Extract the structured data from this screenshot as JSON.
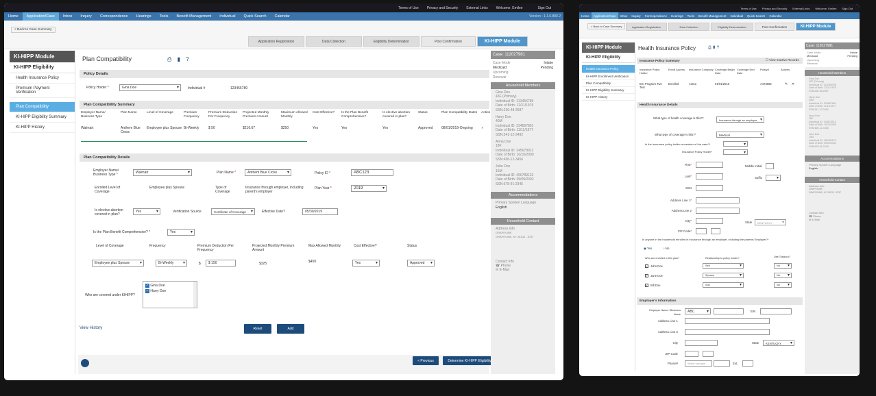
{
  "top_links": [
    "Terms of Use",
    "Privacy and Security",
    "External Links",
    "Welcome, Emilee",
    "Sign Out"
  ],
  "nav": [
    "Home",
    "Application/Case",
    "Inbox",
    "Inquiry",
    "Correspondence",
    "Hearings",
    "Tools",
    "Benefit Management",
    "Individual",
    "Quick Search",
    "Calendar"
  ],
  "version": "Version : 1.1.6.880.2",
  "version_short": "Version : 1.1.6.880.2",
  "back_label": "< Back to Case Summary",
  "steps": [
    "Application Registration",
    "Data Collection",
    "Eligibility Determination",
    "Post Confirmation"
  ],
  "module": "KI-HIPP Module",
  "left": {
    "module": "KI-HIPP Module",
    "section": "KI-HIPP Eligibility",
    "items": [
      "Health Insurance Policy",
      "Premium Payment Verification",
      "Plan Compatibility",
      "KI-HIPP Eligibility Summary",
      "KI-HIPP History"
    ]
  },
  "left2": {
    "module": "KI-HIPP Module",
    "section": "KI-HIPP Eligibility",
    "items": [
      "Health Insurance Policy",
      "KI-HIPP Enrollment Verification",
      "Plan Compatibility",
      "KI-HIPP Eligibility Summary",
      "KI-HIPP History"
    ]
  },
  "page1": {
    "title": "Plan Compatibility",
    "policy_details": "Policy Details",
    "policy_holder_lbl": "Policy Holder",
    "policy_holder": "Gina Doe",
    "individual_lbl": "Individual #",
    "individual": "123456789",
    "summary_title": "Plan Compatibility Summary",
    "summary_headers": [
      "Employer Name/ Business Type",
      "Plan Name",
      "Level of Coverage",
      "Premium Frequency",
      "Premium Deduction Per Frequency",
      "Projected Monthly Premium Amount",
      "Maximum Allowed Monthly",
      "Cost Effective?",
      "Is the Plan Benefit Comprehensive?",
      "Is elective abortion covered in plan?",
      "Status",
      "Plan Compatibility Dates",
      "Action"
    ],
    "summary_row": [
      "Walmart",
      "Anthem Blue Cross",
      "Employee plus Spouse",
      "Bi-Weekly",
      "$ 50",
      "$216.67",
      "$250",
      "Yes",
      "Yes",
      "Yes",
      "Approved",
      "08/01/2019-Ongoing",
      "✓"
    ],
    "details_title": "Plan Compatibility Details",
    "employer_lbl": "Employer Name/ Business Type",
    "employer": "Walmart",
    "plan_name_lbl": "Plan Name",
    "plan_name": "Anthem Blue Cross",
    "policy_id_lbl": "Policy ID",
    "policy_id": "ABC123",
    "enrolled_lbl": "Enrolled Level of Coverage",
    "enrolled": "Employee plus Spouse",
    "type_lbl": "Type of Coverage",
    "type": "Insurance through employer, including parent's employer",
    "plan_year_lbl": "Plan Year",
    "plan_year": "2019",
    "abortion_lbl": "Is elective abortion covered in plan?",
    "abortion": "Yes",
    "verif_lbl": "Verification Source",
    "verif": "Certificate of Coverage",
    "eff_lbl": "Effective Date?",
    "eff": "05/30/2019",
    "comp_lbl": "Is the Plan Benefit Comprehensive?",
    "comp": "Yes",
    "grid_headers": [
      "Level of Coverage",
      "Frequency",
      "Premium Deduction Per Frequency",
      "Projected Monthly Premium Amount",
      "Max Allowed Monthly",
      "Cost Effective?",
      "Status"
    ],
    "grid_row": {
      "level": "Employee plus Spouse",
      "freq": "Bi-Weekly",
      "dollar": "$",
      "ded": "$ 150",
      "proj": "$325",
      "max": "$450",
      "cost": "Yes",
      "status": "Approved"
    },
    "covered_lbl": "Who are covered under KIHIPP?",
    "covered": [
      "Gina Doe",
      "Harry Doe"
    ],
    "view_history": "View History",
    "reset": "Reset",
    "add": "Add",
    "prev": "< Previous",
    "determine": "Determine KI-HIPP Eligibility"
  },
  "case": {
    "label": "Case:",
    "num": "112027981",
    "mode_lbl": "Case Mode",
    "mode": "Intake",
    "prog": "Medicaid",
    "status": "Pending",
    "renewal": "Upcoming Renewal"
  },
  "household_title": "Household Members",
  "members": [
    {
      "name": "Gina Doe",
      "l2": "43F (Primary)",
      "l3": "Individual ID: 123456789",
      "l4": "Date of Birth: 12/11/1976",
      "l5": "SSN:236-48-2687"
    },
    {
      "name": "Harry Doe",
      "l2": "40M",
      "l3": "Individual ID: 234567891",
      "l4": "Date of Birth: 11/11/1977",
      "l5": "SSN:341-12-3492"
    },
    {
      "name": "Anna Doe",
      "l2": "18F",
      "l3": "Individual ID: 345678912",
      "l4": "Date of Birth: 10/10/2000",
      "l5": "SSN:456-12-3456"
    },
    {
      "name": "John Doe",
      "l2": "15M",
      "l3": "Individual ID: 456789123",
      "l4": "Date of Birth: 09/09/2002",
      "l5": "SSN:678-91-2345"
    }
  ],
  "accom_title": "Accommodations",
  "lang_lbl": "Primary Spoken Language",
  "lang": "English",
  "contact_title": "Household Contact",
  "addr_lbl": "Address Info",
  "addr1": "GRAPEVINE",
  "addr2": "GRAPEVINE, KY 26133 - 8757",
  "contact_lbl": "Contact Info",
  "phone": "Phone",
  "email": "E-Mail",
  "page2": {
    "title": "Health Insurance Policy",
    "summary": "Insurance Policy Summary",
    "inactive": "View Inactive Records",
    "headers": [
      "Insurance Policy Holder",
      "Enroll Access",
      "Insurance Company",
      "Coverage Begin Date",
      "Coverage End Date",
      "Policy#",
      "Actions"
    ],
    "row": [
      "ESI Program Two Test",
      "Enrolled",
      "Aetna",
      "01/01/2018",
      "",
      "A473982"
    ],
    "details": "Health Insurance Details",
    "q_type": "What type of health coverage is this?",
    "type_val": "Insurance through an employer",
    "q_cov": "What type of coverage is this?",
    "cov_val": "Medical",
    "q_member": "Is the insurance policy holder a member of the case?",
    "q_holder": "Insurance Policy Holder",
    "first": "First",
    "middle": "Middle Initial",
    "last": "Last",
    "suffix": "Suffix",
    "ssn": "SSN",
    "addr1": "Address Line 1",
    "addr2": "Address Line 2",
    "city": "City",
    "state": "State",
    "state_val": "KENTUCKY",
    "zip": "ZIP Code",
    "q_enrolled": "Is anyone in the household enrolled in insurance through an employer, including the parents Employer?",
    "yes": "Yes",
    "no": "No",
    "q_who": "Who are enrolled in this plan?",
    "q_rel": "Relationship to policy holder?",
    "q_tob": "Use Tobacco?",
    "people": [
      {
        "n": "John Doe",
        "r": "Self",
        "t": "No"
      },
      {
        "n": "Jane Doe",
        "r": "Spouse",
        "t": "No"
      },
      {
        "n": "Bill Doe",
        "r": "Son",
        "t": "No"
      }
    ],
    "emp_title": "Employer's Information",
    "emp_lbl": "Employer Name / Business Name",
    "emp_val": "ABC",
    "ein": "EIN",
    "phone": "Phone#",
    "phone_ph": "Select one type",
    "ext": "Ext."
  },
  "case2": {
    "label": "Case:",
    "num": "112027981",
    "mode_lbl": "Case Mode",
    "mode": "Intake",
    "prog": "Medicaid",
    "status": "Pending",
    "renewal": "Upcoming Renewal"
  }
}
